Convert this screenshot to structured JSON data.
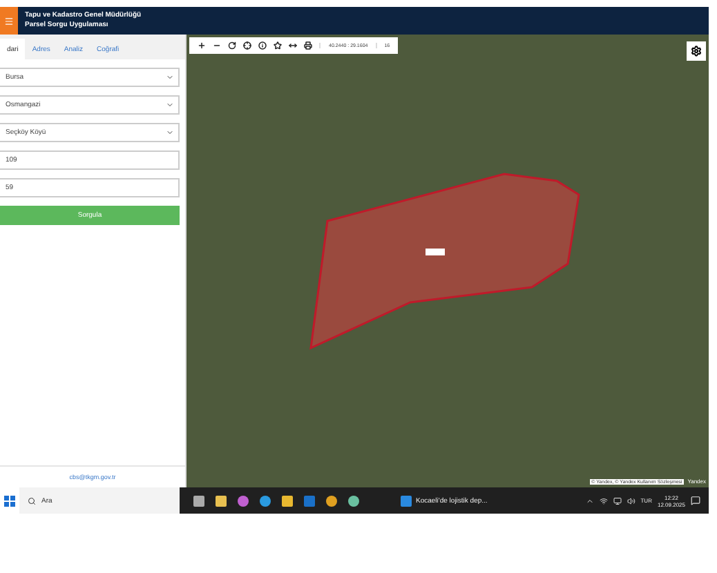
{
  "header": {
    "title": "Tapu ve Kadastro Genel Müdürlüğü",
    "subtitle": "Parsel Sorgu Uygulaması"
  },
  "tabs": [
    {
      "label": "dari",
      "selected": true
    },
    {
      "label": "Adres",
      "selected": false
    },
    {
      "label": "Analiz",
      "selected": false
    },
    {
      "label": "Coğrafi",
      "selected": false
    }
  ],
  "form": {
    "fields": [
      {
        "kind": "select",
        "value": "Bursa"
      },
      {
        "kind": "select",
        "value": "Osmangazi"
      },
      {
        "kind": "select",
        "value": "Seçköy Köyü"
      },
      {
        "kind": "input",
        "value": "109"
      },
      {
        "kind": "input",
        "value": "59"
      }
    ],
    "button": "Sorgula"
  },
  "footer": {
    "email": "cbs@tkgm.gov.tr"
  },
  "map": {
    "coordinates": "40.2440 : 29.1604",
    "zoom": "16",
    "attribution": "© Yandex, © Yandex Kullanım Sözleşmesi",
    "brand": "Yandex"
  },
  "taskbar": {
    "search": "Ara",
    "task": "Kocaeli'de lojistik dep...",
    "language": "TUR",
    "time": "12:22",
    "date": "12.09.2025"
  }
}
